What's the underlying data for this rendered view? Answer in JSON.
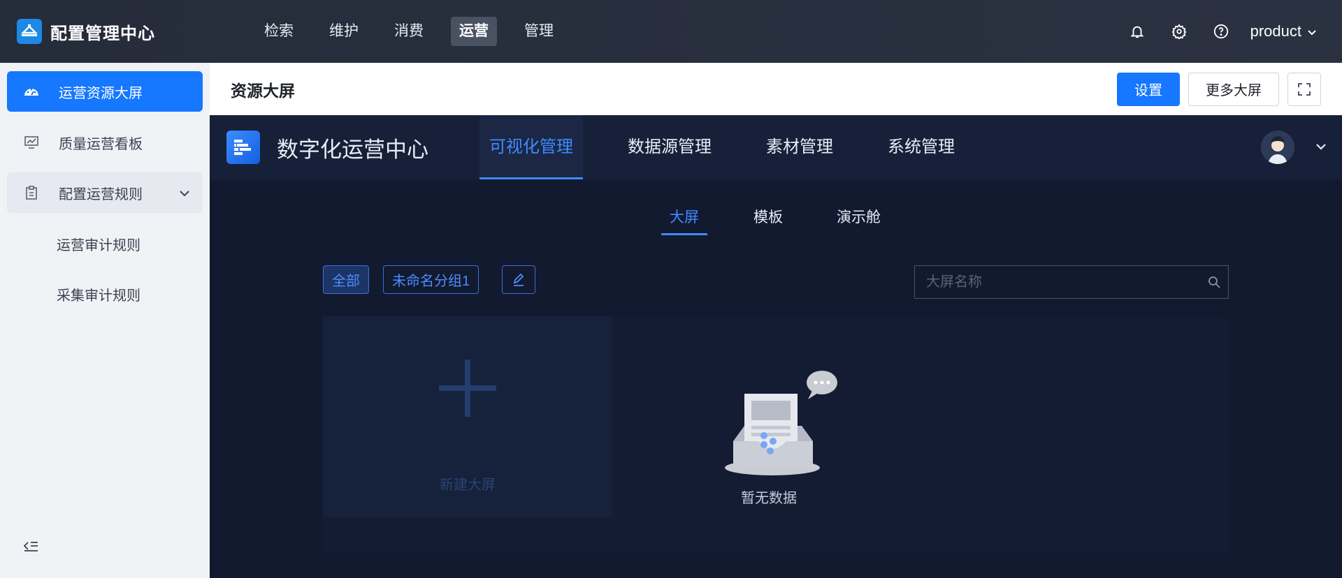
{
  "app": {
    "title": "配置管理中心"
  },
  "topnav": {
    "items": [
      {
        "label": "检索",
        "active": false
      },
      {
        "label": "维护",
        "active": false
      },
      {
        "label": "消费",
        "active": false
      },
      {
        "label": "运营",
        "active": true
      },
      {
        "label": "管理",
        "active": false
      }
    ]
  },
  "user": {
    "name": "product"
  },
  "sidebar": {
    "items": [
      {
        "label": "运营资源大屏",
        "icon": "dashboard-icon",
        "active": true
      },
      {
        "label": "质量运营看板",
        "icon": "monitor-chart-icon",
        "active": false
      },
      {
        "label": "配置运营规则",
        "icon": "clipboard-icon",
        "expanded": true
      }
    ],
    "subitems": [
      {
        "label": "运营审计规则"
      },
      {
        "label": "采集审计规则"
      }
    ]
  },
  "page": {
    "title": "资源大屏",
    "settings_label": "设置",
    "more_label": "更多大屏"
  },
  "embed": {
    "title": "数字化运营中心",
    "menu": [
      {
        "label": "可视化管理",
        "active": true
      },
      {
        "label": "数据源管理",
        "active": false
      },
      {
        "label": "素材管理",
        "active": false
      },
      {
        "label": "系统管理",
        "active": false
      }
    ],
    "tabs": [
      {
        "label": "大屏",
        "active": true
      },
      {
        "label": "模板",
        "active": false
      },
      {
        "label": "演示舱",
        "active": false
      }
    ],
    "groups": [
      {
        "label": "全部",
        "active": true
      },
      {
        "label": "未命名分组1",
        "active": false
      }
    ],
    "search": {
      "placeholder": "大屏名称",
      "value": ""
    },
    "new_label": "新建大屏",
    "empty_label": "暂无数据"
  },
  "colors": {
    "accent": "#1677ff",
    "topbar": "#262d3b",
    "embed_bg": "#121a30",
    "embed_active": "#3d8bff"
  }
}
